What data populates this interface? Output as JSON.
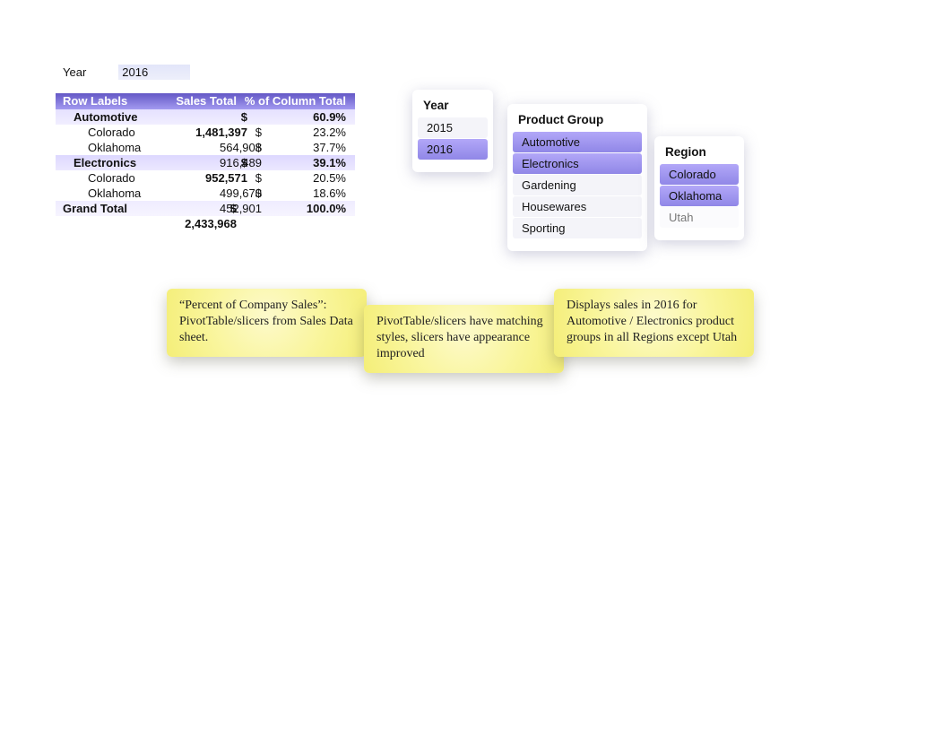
{
  "filter": {
    "label": "Year",
    "value": "2016"
  },
  "pivot": {
    "columns": {
      "row_labels": "Row Labels",
      "sales_total": "Sales Total",
      "pct_col_total": "% of Column Total"
    },
    "rows": [
      {
        "type": "group",
        "label": "Automotive",
        "currency": "$",
        "amount": "1,481,397",
        "pct": "60.9%"
      },
      {
        "type": "detail",
        "label": "Colorado",
        "currency": "$",
        "amount": "564,908",
        "pct": "23.2%"
      },
      {
        "type": "detail",
        "label": "Oklahoma",
        "currency": "$",
        "amount": "916,489",
        "pct": "37.7%"
      },
      {
        "type": "group",
        "label": "Electronics",
        "currency": "$",
        "amount": "952,571",
        "pct": "39.1%"
      },
      {
        "type": "detail",
        "label": "Colorado",
        "currency": "$",
        "amount": "499,670",
        "pct": "20.5%"
      },
      {
        "type": "detail",
        "label": "Oklahoma",
        "currency": "$",
        "amount": "452,901",
        "pct": "18.6%"
      }
    ],
    "grand_total": {
      "label": "Grand Total",
      "currency": "$",
      "amount": "2,433,968",
      "pct": "100.0%"
    }
  },
  "slicers": {
    "year": {
      "title": "Year",
      "items": [
        {
          "label": "2015",
          "selected": false
        },
        {
          "label": "2016",
          "selected": true
        }
      ]
    },
    "product_group": {
      "title": "Product Group",
      "items": [
        {
          "label": "Automotive",
          "selected": true
        },
        {
          "label": "Electronics",
          "selected": true
        },
        {
          "label": "Gardening",
          "selected": false
        },
        {
          "label": "Housewares",
          "selected": false
        },
        {
          "label": "Sporting",
          "selected": false
        }
      ]
    },
    "region": {
      "title": "Region",
      "items": [
        {
          "label": "Colorado",
          "selected": true
        },
        {
          "label": "Oklahoma",
          "selected": true
        },
        {
          "label": "Utah",
          "selected": false,
          "dim": true
        }
      ]
    }
  },
  "notes": {
    "n1": "“Percent of Company Sales”: PivotTable/slicers from Sales Data sheet.",
    "n2": "PivotTable/slicers have matching styles, slicers have appearance improved",
    "n3": "Displays sales in 2016 for Automotive / Electronics product groups in all Regions except Utah"
  }
}
